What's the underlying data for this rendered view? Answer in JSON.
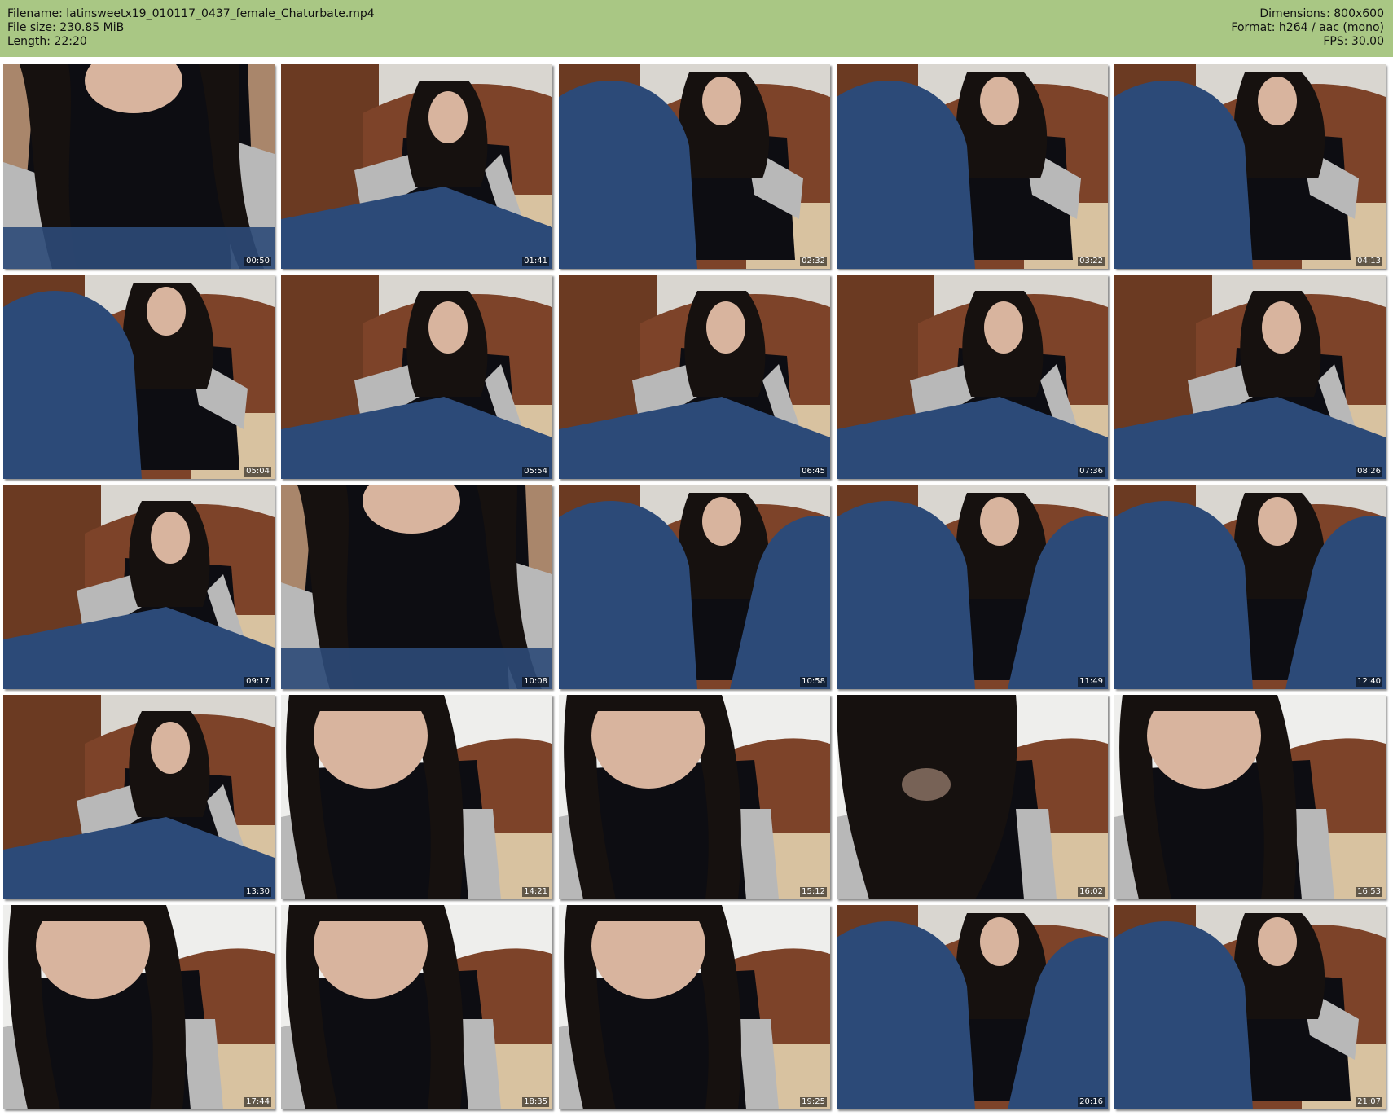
{
  "header": {
    "filename_line": "Filename: latinsweetx19_010117_0437_female_Chaturbate.mp4",
    "filesize_line": "File size: 230.85 MiB",
    "length_line": "Length: 22:20",
    "dimensions_line": "Dimensions: 800x600",
    "format_line": "Format: h264 / aac (mono)",
    "fps_line": "FPS: 30.00"
  },
  "colors": {
    "header_bg": "#a9c784",
    "wall": "#d9d6d0",
    "wood": "#6b3a22",
    "jeans": "#2c4a78",
    "shirt": "#0d0d12",
    "sleeve": "#b8b8b8",
    "hair": "#16110f",
    "skin": "#d8b49e",
    "blanket": "#d8c2a0"
  },
  "thumbnails": [
    {
      "time": "00:50",
      "scene": "closeup-chest"
    },
    {
      "time": "01:41",
      "scene": "bed-left-reclined"
    },
    {
      "time": "02:32",
      "scene": "knees-left"
    },
    {
      "time": "03:22",
      "scene": "knees-left"
    },
    {
      "time": "04:13",
      "scene": "knees-left"
    },
    {
      "time": "05:04",
      "scene": "knees-left"
    },
    {
      "time": "05:54",
      "scene": "bed-center"
    },
    {
      "time": "06:45",
      "scene": "bed-center"
    },
    {
      "time": "07:36",
      "scene": "bed-center"
    },
    {
      "time": "08:26",
      "scene": "bed-center"
    },
    {
      "time": "09:17",
      "scene": "bed-center"
    },
    {
      "time": "10:08",
      "scene": "closeup-chest"
    },
    {
      "time": "10:58",
      "scene": "knees-both"
    },
    {
      "time": "11:49",
      "scene": "knees-both"
    },
    {
      "time": "12:40",
      "scene": "knees-both"
    },
    {
      "time": "13:30",
      "scene": "bed-left-reclined"
    },
    {
      "time": "14:21",
      "scene": "closeup-face"
    },
    {
      "time": "15:12",
      "scene": "closeup-face"
    },
    {
      "time": "16:02",
      "scene": "closeup-hair"
    },
    {
      "time": "16:53",
      "scene": "closeup-face"
    },
    {
      "time": "17:44",
      "scene": "closeup-face"
    },
    {
      "time": "18:35",
      "scene": "closeup-face"
    },
    {
      "time": "19:25",
      "scene": "closeup-face"
    },
    {
      "time": "20:16",
      "scene": "knees-both"
    },
    {
      "time": "21:07",
      "scene": "knees-left"
    }
  ]
}
